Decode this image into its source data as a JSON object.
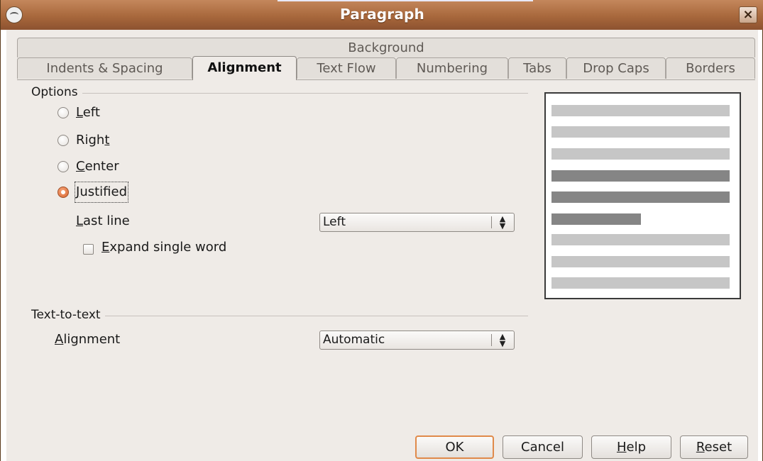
{
  "window": {
    "title": "Paragraph",
    "close_glyph": "×",
    "icon": "app-window-icon"
  },
  "tabs": {
    "background": "Background",
    "row": [
      {
        "label": "Indents & Spacing",
        "active": false
      },
      {
        "label": "Alignment",
        "active": true
      },
      {
        "label": "Text Flow",
        "active": false
      },
      {
        "label": "Numbering",
        "active": false
      },
      {
        "label": "Tabs",
        "active": false
      },
      {
        "label": "Drop Caps",
        "active": false
      },
      {
        "label": "Borders",
        "active": false
      }
    ]
  },
  "options": {
    "title": "Options",
    "radios": [
      {
        "mnemonic": "L",
        "rest": "eft",
        "checked": false
      },
      {
        "pre": "Righ",
        "mnemonic": "t",
        "checked": false
      },
      {
        "mnemonic": "C",
        "rest": "enter",
        "checked": false
      },
      {
        "mnemonic": "J",
        "rest": "ustified",
        "checked": true
      }
    ],
    "last_line": {
      "mnemonic": "L",
      "rest": "ast line",
      "value": "Left"
    },
    "expand_single_word": {
      "mnemonic": "E",
      "rest": "xpand single word",
      "checked": false
    }
  },
  "text_to_text": {
    "title": "Text-to-text",
    "alignment": {
      "mnemonic": "A",
      "rest": "lignment",
      "value": "Automatic"
    }
  },
  "buttons": {
    "ok": "OK",
    "cancel": "Cancel",
    "help": {
      "mnemonic": "H",
      "rest": "elp"
    },
    "reset": {
      "mnemonic": "R",
      "rest": "eset"
    }
  },
  "colors": {
    "titlebar": "#a8683c",
    "radio_checked": "#d9652e",
    "default_button_border": "#e08a4a",
    "dialog_bg": "#efebe7"
  }
}
